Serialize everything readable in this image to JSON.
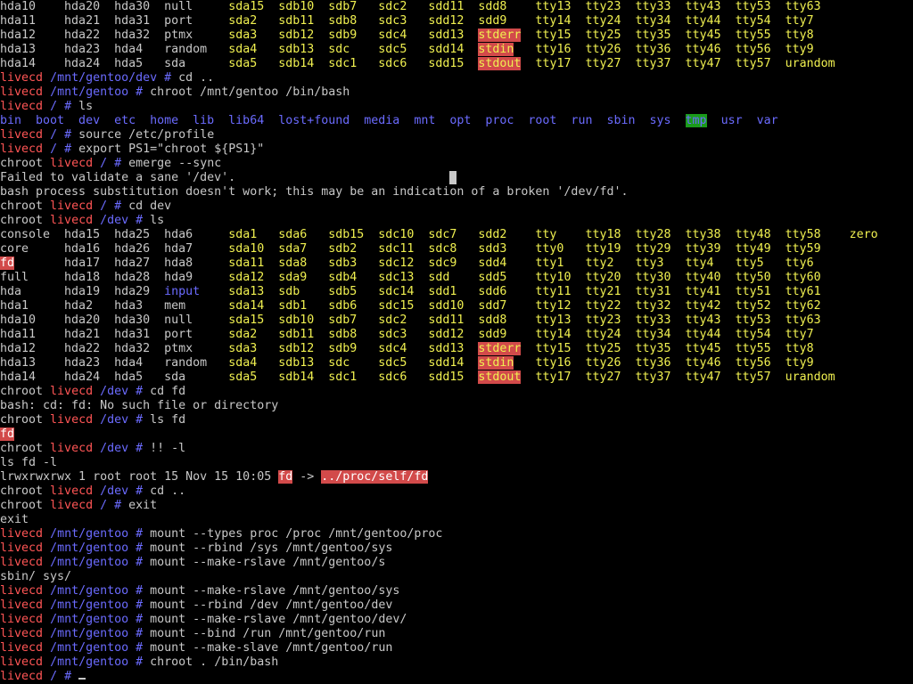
{
  "terminal": {
    "lines": [
      [
        {
          "t": "hda10    hda20  hda30  null     ",
          "c": "white"
        },
        {
          "t": "sda15  sdb10  sdb7   sdc2   sdd11  sdd8    ",
          "c": "yellow"
        },
        {
          "t": "tty13  tty23  tty33  tty43  tty53  tty63",
          "c": "yellow"
        }
      ],
      [
        {
          "t": "hda11    hda21  hda31  port     ",
          "c": "white"
        },
        {
          "t": "sda2   sdb11  sdb8   sdc3   sdd12  sdd9    ",
          "c": "yellow"
        },
        {
          "t": "tty14  tty24  tty34  tty44  tty54  tty7",
          "c": "yellow"
        }
      ],
      [
        {
          "t": "hda12    hda22  hda32  ptmx     ",
          "c": "white"
        },
        {
          "t": "sda3   sdb12  sdb9   sdc4   sdd13  ",
          "c": "yellow"
        },
        {
          "t": "stderr",
          "c": "hlred"
        },
        {
          "t": "  tty15  tty25  tty35  tty45  tty55  tty8",
          "c": "yellow"
        }
      ],
      [
        {
          "t": "hda13    hda23  hda4   random   ",
          "c": "white"
        },
        {
          "t": "sda4   sdb13  sdc    sdc5   sdd14  ",
          "c": "yellow"
        },
        {
          "t": "stdin",
          "c": "hlred"
        },
        {
          "t": "   tty16  tty26  tty36  tty46  tty56  tty9",
          "c": "yellow"
        }
      ],
      [
        {
          "t": "hda14    hda24  hda5   sda      ",
          "c": "white"
        },
        {
          "t": "sda5   sdb14  sdc1   sdc6   sdd15  ",
          "c": "yellow"
        },
        {
          "t": "stdout",
          "c": "hlred"
        },
        {
          "t": "  tty17  tty27  tty37  tty47  tty57  urandom",
          "c": "yellow"
        }
      ],
      [
        {
          "t": "livecd",
          "c": "red"
        },
        {
          "t": " ",
          "c": "white"
        },
        {
          "t": "/mnt/gentoo/dev #",
          "c": "blue"
        },
        {
          "t": " cd ..",
          "c": "white"
        }
      ],
      [
        {
          "t": "livecd",
          "c": "red"
        },
        {
          "t": " ",
          "c": "white"
        },
        {
          "t": "/mnt/gentoo #",
          "c": "blue"
        },
        {
          "t": " chroot /mnt/gentoo /bin/bash",
          "c": "white"
        }
      ],
      [
        {
          "t": "livecd",
          "c": "red"
        },
        {
          "t": " ",
          "c": "white"
        },
        {
          "t": "/ #",
          "c": "blue"
        },
        {
          "t": " ls",
          "c": "white"
        }
      ],
      [
        {
          "t": "bin  boot  dev  etc  home  lib  lib64  lost+found  media  mnt  opt  proc  root  run  sbin  sys  ",
          "c": "blue"
        },
        {
          "t": "tmp",
          "c": "green"
        },
        {
          "t": "  usr  var",
          "c": "blue"
        }
      ],
      [
        {
          "t": "livecd",
          "c": "red"
        },
        {
          "t": " ",
          "c": "white"
        },
        {
          "t": "/ #",
          "c": "blue"
        },
        {
          "t": " source /etc/profile",
          "c": "white"
        }
      ],
      [
        {
          "t": "livecd",
          "c": "red"
        },
        {
          "t": " ",
          "c": "white"
        },
        {
          "t": "/ #",
          "c": "blue"
        },
        {
          "t": " export PS1=\"chroot ${PS1}\"",
          "c": "white"
        }
      ],
      [
        {
          "t": "chroot ",
          "c": "white"
        },
        {
          "t": "livecd",
          "c": "red"
        },
        {
          "t": " ",
          "c": "white"
        },
        {
          "t": "/ #",
          "c": "blue"
        },
        {
          "t": " emerge --sync",
          "c": "white"
        }
      ],
      [
        {
          "t": "Failed to validate a sane '/dev'.",
          "c": "white"
        }
      ],
      [
        {
          "t": "bash process substitution doesn't work; this may be an indication of a broken '/dev/fd'.",
          "c": "white"
        }
      ],
      [
        {
          "t": "chroot ",
          "c": "white"
        },
        {
          "t": "livecd",
          "c": "red"
        },
        {
          "t": " ",
          "c": "white"
        },
        {
          "t": "/ #",
          "c": "blue"
        },
        {
          "t": " cd dev",
          "c": "white"
        }
      ],
      [
        {
          "t": "chroot ",
          "c": "white"
        },
        {
          "t": "livecd",
          "c": "red"
        },
        {
          "t": " ",
          "c": "white"
        },
        {
          "t": "/dev #",
          "c": "blue"
        },
        {
          "t": " ls",
          "c": "white"
        }
      ],
      [
        {
          "t": "console  hda15  hda25  hda6     ",
          "c": "white"
        },
        {
          "t": "sda1   sda6   sdb15  sdc10  sdc7   sdd2    tty    tty18  tty28  tty38  tty48  tty58    zero",
          "c": "yellow"
        }
      ],
      [
        {
          "t": "core     hda16  hda26  hda7     ",
          "c": "white"
        },
        {
          "t": "sda10  sda7   sdb2   sdc11  sdc8   sdd3    tty0   tty19  tty29  tty39  tty49  tty59",
          "c": "yellow"
        }
      ],
      [
        {
          "t": "fd",
          "c": "hlred-w"
        },
        {
          "t": "       hda17  hda27  hda8     ",
          "c": "white"
        },
        {
          "t": "sda11  sda8   sdb3   sdc12  sdc9   sdd4    tty1   tty2   tty3   tty4   tty5   tty6",
          "c": "yellow"
        }
      ],
      [
        {
          "t": "full     hda18  hda28  hda9     ",
          "c": "white"
        },
        {
          "t": "sda12  sda9   sdb4   sdc13  sdd    sdd5    tty10  tty20  tty30  tty40  tty50  tty60",
          "c": "yellow"
        }
      ],
      [
        {
          "t": "hda      hda19  hda29  ",
          "c": "white"
        },
        {
          "t": "input",
          "c": "blue"
        },
        {
          "t": "    ",
          "c": "white"
        },
        {
          "t": "sda13  sdb    sdb5   sdc14  sdd1   sdd6    tty11  tty21  tty31  tty41  tty51  tty61",
          "c": "yellow"
        }
      ],
      [
        {
          "t": "hda1     hda2   hda3   mem      ",
          "c": "white"
        },
        {
          "t": "sda14  sdb1   sdb6   sdc15  sdd10  sdd7    tty12  tty22  tty32  tty42  tty52  tty62",
          "c": "yellow"
        }
      ],
      [
        {
          "t": "hda10    hda20  hda30  null     ",
          "c": "white"
        },
        {
          "t": "sda15  sdb10  sdb7   sdc2   sdd11  sdd8    tty13  tty23  tty33  tty43  tty53  tty63",
          "c": "yellow"
        }
      ],
      [
        {
          "t": "hda11    hda21  hda31  port     ",
          "c": "white"
        },
        {
          "t": "sda2   sdb11  sdb8   sdc3   sdd12  sdd9    tty14  tty24  tty34  tty44  tty54  tty7",
          "c": "yellow"
        }
      ],
      [
        {
          "t": "hda12    hda22  hda32  ptmx     ",
          "c": "white"
        },
        {
          "t": "sda3   sdb12  sdb9   sdc4   sdd13  ",
          "c": "yellow"
        },
        {
          "t": "stderr",
          "c": "hlred"
        },
        {
          "t": "  tty15  tty25  tty35  tty45  tty55  tty8",
          "c": "yellow"
        }
      ],
      [
        {
          "t": "hda13    hda23  hda4   random   ",
          "c": "white"
        },
        {
          "t": "sda4   sdb13  sdc    sdc5   sdd14  ",
          "c": "yellow"
        },
        {
          "t": "stdin",
          "c": "hlred"
        },
        {
          "t": "   tty16  tty26  tty36  tty46  tty56  tty9",
          "c": "yellow"
        }
      ],
      [
        {
          "t": "hda14    hda24  hda5   sda      ",
          "c": "white"
        },
        {
          "t": "sda5   sdb14  sdc1   sdc6   sdd15  ",
          "c": "yellow"
        },
        {
          "t": "stdout",
          "c": "hlred"
        },
        {
          "t": "  tty17  tty27  tty37  tty47  tty57  urandom",
          "c": "yellow"
        }
      ],
      [
        {
          "t": "chroot ",
          "c": "white"
        },
        {
          "t": "livecd",
          "c": "red"
        },
        {
          "t": " ",
          "c": "white"
        },
        {
          "t": "/dev #",
          "c": "blue"
        },
        {
          "t": " cd fd",
          "c": "white"
        }
      ],
      [
        {
          "t": "bash: cd: fd: No such file or directory",
          "c": "white"
        }
      ],
      [
        {
          "t": "chroot ",
          "c": "white"
        },
        {
          "t": "livecd",
          "c": "red"
        },
        {
          "t": " ",
          "c": "white"
        },
        {
          "t": "/dev #",
          "c": "blue"
        },
        {
          "t": " ls fd",
          "c": "white"
        }
      ],
      [
        {
          "t": "fd",
          "c": "hlred-w"
        }
      ],
      [
        {
          "t": "chroot ",
          "c": "white"
        },
        {
          "t": "livecd",
          "c": "red"
        },
        {
          "t": " ",
          "c": "white"
        },
        {
          "t": "/dev #",
          "c": "blue"
        },
        {
          "t": " !! -l",
          "c": "white"
        }
      ],
      [
        {
          "t": "ls fd -l",
          "c": "white"
        }
      ],
      [
        {
          "t": "lrwxrwxrwx 1 root root 15 Nov 15 10:05 ",
          "c": "white"
        },
        {
          "t": "fd",
          "c": "hlred-w"
        },
        {
          "t": " -> ",
          "c": "white"
        },
        {
          "t": "../proc/self/fd",
          "c": "hlred-w"
        }
      ],
      [
        {
          "t": "chroot ",
          "c": "white"
        },
        {
          "t": "livecd",
          "c": "red"
        },
        {
          "t": " ",
          "c": "white"
        },
        {
          "t": "/dev #",
          "c": "blue"
        },
        {
          "t": " cd ..",
          "c": "white"
        }
      ],
      [
        {
          "t": "chroot ",
          "c": "white"
        },
        {
          "t": "livecd",
          "c": "red"
        },
        {
          "t": " ",
          "c": "white"
        },
        {
          "t": "/ #",
          "c": "blue"
        },
        {
          "t": " exit",
          "c": "white"
        }
      ],
      [
        {
          "t": "exit",
          "c": "white"
        }
      ],
      [
        {
          "t": "livecd",
          "c": "red"
        },
        {
          "t": " ",
          "c": "white"
        },
        {
          "t": "/mnt/gentoo #",
          "c": "blue"
        },
        {
          "t": " mount --types proc /proc /mnt/gentoo/proc",
          "c": "white"
        }
      ],
      [
        {
          "t": "livecd",
          "c": "red"
        },
        {
          "t": " ",
          "c": "white"
        },
        {
          "t": "/mnt/gentoo #",
          "c": "blue"
        },
        {
          "t": " mount --rbind /sys /mnt/gentoo/sys",
          "c": "white"
        }
      ],
      [
        {
          "t": "livecd",
          "c": "red"
        },
        {
          "t": " ",
          "c": "white"
        },
        {
          "t": "/mnt/gentoo #",
          "c": "blue"
        },
        {
          "t": " mount --make-rslave /mnt/gentoo/s",
          "c": "white"
        }
      ],
      [
        {
          "t": "sbin/ sys/",
          "c": "white"
        }
      ],
      [
        {
          "t": "livecd",
          "c": "red"
        },
        {
          "t": " ",
          "c": "white"
        },
        {
          "t": "/mnt/gentoo #",
          "c": "blue"
        },
        {
          "t": " mount --make-rslave /mnt/gentoo/sys",
          "c": "white"
        }
      ],
      [
        {
          "t": "livecd",
          "c": "red"
        },
        {
          "t": " ",
          "c": "white"
        },
        {
          "t": "/mnt/gentoo #",
          "c": "blue"
        },
        {
          "t": " mount --rbind /dev /mnt/gentoo/dev",
          "c": "white"
        }
      ],
      [
        {
          "t": "livecd",
          "c": "red"
        },
        {
          "t": " ",
          "c": "white"
        },
        {
          "t": "/mnt/gentoo #",
          "c": "blue"
        },
        {
          "t": " mount --make-rslave /mnt/gentoo/dev/",
          "c": "white"
        }
      ],
      [
        {
          "t": "livecd",
          "c": "red"
        },
        {
          "t": " ",
          "c": "white"
        },
        {
          "t": "/mnt/gentoo #",
          "c": "blue"
        },
        {
          "t": " mount --bind /run /mnt/gentoo/run",
          "c": "white"
        }
      ],
      [
        {
          "t": "livecd",
          "c": "red"
        },
        {
          "t": " ",
          "c": "white"
        },
        {
          "t": "/mnt/gentoo #",
          "c": "blue"
        },
        {
          "t": " mount --make-slave /mnt/gentoo/run",
          "c": "white"
        }
      ],
      [
        {
          "t": "livecd",
          "c": "red"
        },
        {
          "t": " ",
          "c": "white"
        },
        {
          "t": "/mnt/gentoo #",
          "c": "blue"
        },
        {
          "t": " chroot . /bin/bash",
          "c": "white"
        }
      ],
      [
        {
          "t": "livecd",
          "c": "red"
        },
        {
          "t": " ",
          "c": "white"
        },
        {
          "t": "/ #",
          "c": "blue"
        },
        {
          "t": " ",
          "c": "white"
        }
      ]
    ],
    "colors": {
      "background": "#000000",
      "foreground": "#c8c8c8",
      "prompt_host": "#ff5555",
      "prompt_path": "#6b6bff",
      "device_files": "#f0f050",
      "highlight_bg": "#d24a4a",
      "dir_sticky_bg": "#1a9a1a"
    },
    "cursor_icon": "block-cursor"
  }
}
